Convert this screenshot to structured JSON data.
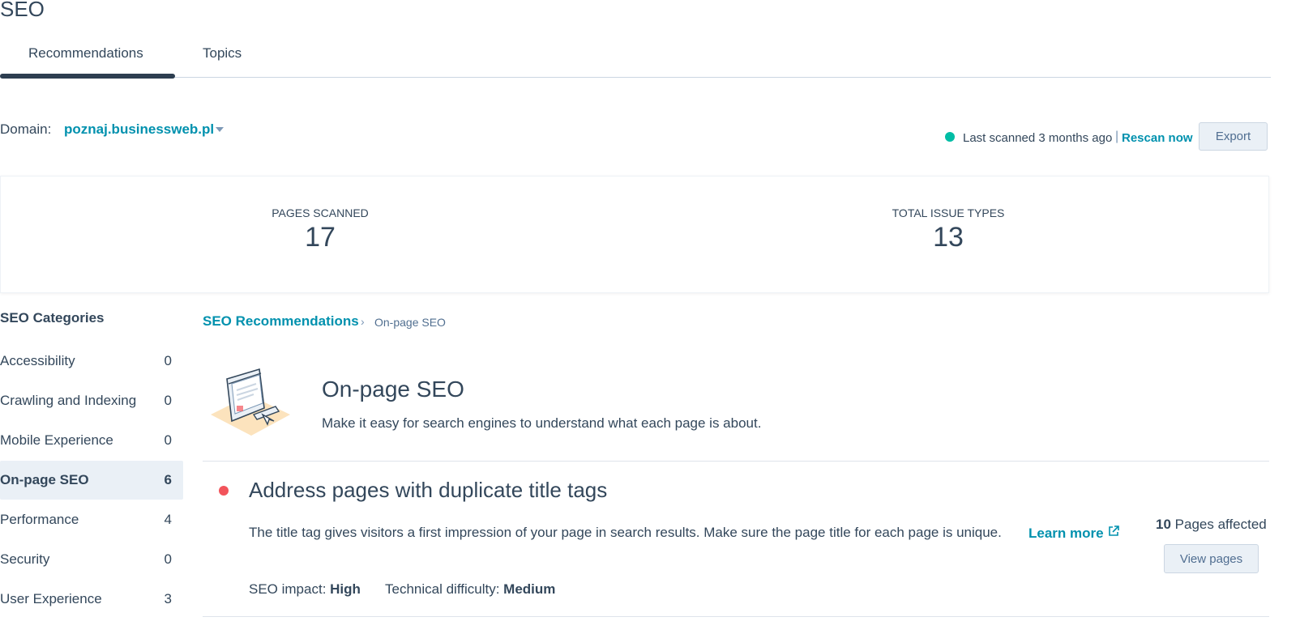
{
  "page_title": "SEO",
  "tabs": [
    {
      "label": "Recommendations",
      "active": true
    },
    {
      "label": "Topics",
      "active": false
    }
  ],
  "domain": {
    "label": "Domain:",
    "value": "poznaj.businessweb.pl"
  },
  "scan": {
    "status_color": "#00bda5",
    "last_scanned": "Last scanned 3 months ago",
    "separator": "|",
    "rescan_label": "Rescan now",
    "export_label": "Export"
  },
  "stats": {
    "pages_scanned_label": "PAGES SCANNED",
    "pages_scanned_value": "17",
    "issue_types_label": "TOTAL ISSUE TYPES",
    "issue_types_value": "13"
  },
  "categories": {
    "heading": "SEO Categories",
    "items": [
      {
        "label": "Accessibility",
        "count": "0"
      },
      {
        "label": "Crawling and Indexing",
        "count": "0"
      },
      {
        "label": "Mobile Experience",
        "count": "0"
      },
      {
        "label": "On-page SEO",
        "count": "6",
        "active": true
      },
      {
        "label": "Performance",
        "count": "4"
      },
      {
        "label": "Security",
        "count": "0"
      },
      {
        "label": "User Experience",
        "count": "3"
      }
    ]
  },
  "breadcrumb": {
    "parent": "SEO Recommendations",
    "separator": "›",
    "current": "On-page SEO"
  },
  "section": {
    "title": "On-page SEO",
    "description": "Make it easy for search engines to understand what each page is about.",
    "illustration": "browser-window-illustration"
  },
  "recommendation": {
    "severity_color": "#f2545b",
    "title": "Address pages with duplicate title tags",
    "description": "The title tag gives visitors a first impression of your page in search results. Make sure the page title for each page is unique.",
    "learn_more": "Learn more",
    "pages_affected_count": "10",
    "pages_affected_label": "Pages affected",
    "view_pages_label": "View pages",
    "impact_label": "SEO impact:",
    "impact_value": "High",
    "difficulty_label": "Technical difficulty:",
    "difficulty_value": "Medium"
  },
  "colors": {
    "accent": "#0091ae",
    "text": "#33475b",
    "active_tab_bar": "#2d3e50"
  }
}
